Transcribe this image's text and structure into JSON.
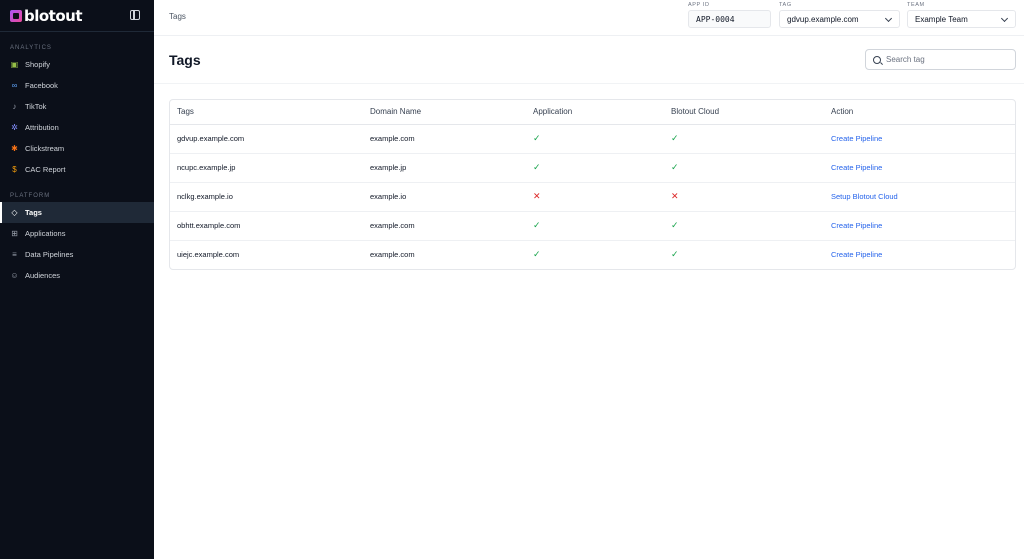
{
  "brand": {
    "name": "blotout"
  },
  "sidebar": {
    "sections": [
      {
        "label": "ANALYTICS",
        "items": [
          "Shopify",
          "Facebook",
          "TikTok",
          "Attribution",
          "Clickstream",
          "CAC Report"
        ]
      },
      {
        "label": "PLATFORM",
        "items": [
          "Tags",
          "Applications",
          "Data Pipelines",
          "Audiences"
        ]
      }
    ],
    "icons": {
      "Shopify": "shopping-bag-icon",
      "Facebook": "meta-icon",
      "TikTok": "tiktok-icon",
      "Attribution": "attribution-icon",
      "Clickstream": "clickstream-icon",
      "CAC Report": "dollar-icon",
      "Tags": "tag-icon",
      "Applications": "grid-icon",
      "Data Pipelines": "database-icon",
      "Audiences": "users-icon"
    },
    "active": "Tags"
  },
  "topbar": {
    "breadcrumb": "Tags",
    "app_id": {
      "label": "APP ID",
      "value": "APP-0004"
    },
    "tag": {
      "label": "TAG",
      "value": "gdvup.example.com"
    },
    "team": {
      "label": "TEAM",
      "value": "Example Team"
    }
  },
  "main": {
    "title": "Tags",
    "search_placeholder": "Search tag",
    "table": {
      "columns": [
        "Tags",
        "Domain Name",
        "Application",
        "Blotout Cloud",
        "Action"
      ],
      "rows": [
        {
          "tag": "gdvup.example.com",
          "domain": "example.com",
          "application": true,
          "cloud": true,
          "action": "Create Pipeline"
        },
        {
          "tag": "ncupc.example.jp",
          "domain": "example.jp",
          "application": true,
          "cloud": true,
          "action": "Create Pipeline"
        },
        {
          "tag": "nclkg.example.io",
          "domain": "example.io",
          "application": false,
          "cloud": false,
          "action": "Setup Blotout Cloud"
        },
        {
          "tag": "obhtt.example.com",
          "domain": "example.com",
          "application": true,
          "cloud": true,
          "action": "Create Pipeline"
        },
        {
          "tag": "uiejc.example.com",
          "domain": "example.com",
          "application": true,
          "cloud": true,
          "action": "Create Pipeline"
        }
      ]
    }
  },
  "colors": {
    "sidebar_bg": "#0b0f19",
    "check": "#16a34a",
    "cross": "#dc2626",
    "link": "#2563eb"
  }
}
